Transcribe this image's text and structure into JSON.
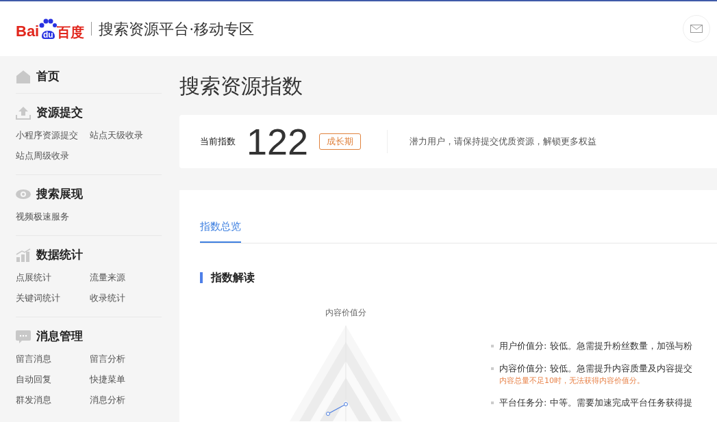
{
  "header": {
    "logo": {
      "left": "Bai",
      "badge": "du",
      "right": "百度"
    },
    "title": "搜索资源平台·移动专区"
  },
  "sidebar": {
    "sections": [
      {
        "title": "首页"
      },
      {
        "title": "资源提交",
        "items": [
          "小程序资源提交",
          "站点天级收录",
          "站点周级收录"
        ]
      },
      {
        "title": "搜索展现",
        "items": [
          "视频极速服务"
        ]
      },
      {
        "title": "数据统计",
        "items": [
          "点展统计",
          "流量来源",
          "关键词统计",
          "收录统计"
        ]
      },
      {
        "title": "消息管理",
        "items": [
          "留言消息",
          "留言分析",
          "自动回复",
          "快捷菜单",
          "群发消息",
          "消息分析"
        ]
      }
    ]
  },
  "page_title": "搜索资源指数",
  "index_card": {
    "label": "当前指数",
    "value": "122",
    "stage": "成长期",
    "message": "潜力用户，请保持提交优质资源，解锁更多权益"
  },
  "tabs": [
    {
      "label": "指数总览",
      "selected": true
    }
  ],
  "section_title": "指数解读",
  "radar": {
    "axis_label": "内容价值分"
  },
  "notes": [
    {
      "text": "用户价值分: 较低。急需提升粉丝数量，加强与粉"
    },
    {
      "text": "内容价值分: 较低。急需提升内容质量及内容提交",
      "warning": "内容总量不足10时，无法获得内容价值分。"
    },
    {
      "text": "平台任务分: 中等。需要加速完成平台任务获得提"
    }
  ]
}
